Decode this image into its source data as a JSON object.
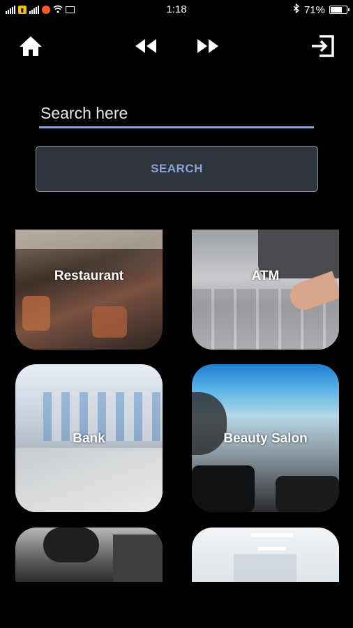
{
  "status_bar": {
    "time": "1:18",
    "battery": "71%"
  },
  "toolbar": {
    "icons": [
      "home-icon",
      "rewind-icon",
      "fast-forward-icon",
      "exit-icon"
    ]
  },
  "search": {
    "placeholder": "Search here",
    "value": "",
    "button_label": "SEARCH"
  },
  "categories": [
    {
      "label": "Restaurant"
    },
    {
      "label": "ATM"
    },
    {
      "label": "Bank"
    },
    {
      "label": "Beauty Salon"
    },
    {
      "label": ""
    },
    {
      "label": ""
    }
  ],
  "colors": {
    "background": "#000000",
    "accent": "#7fa8f5",
    "button_bg": "#2f333c",
    "button_text": "#86a6d9"
  }
}
